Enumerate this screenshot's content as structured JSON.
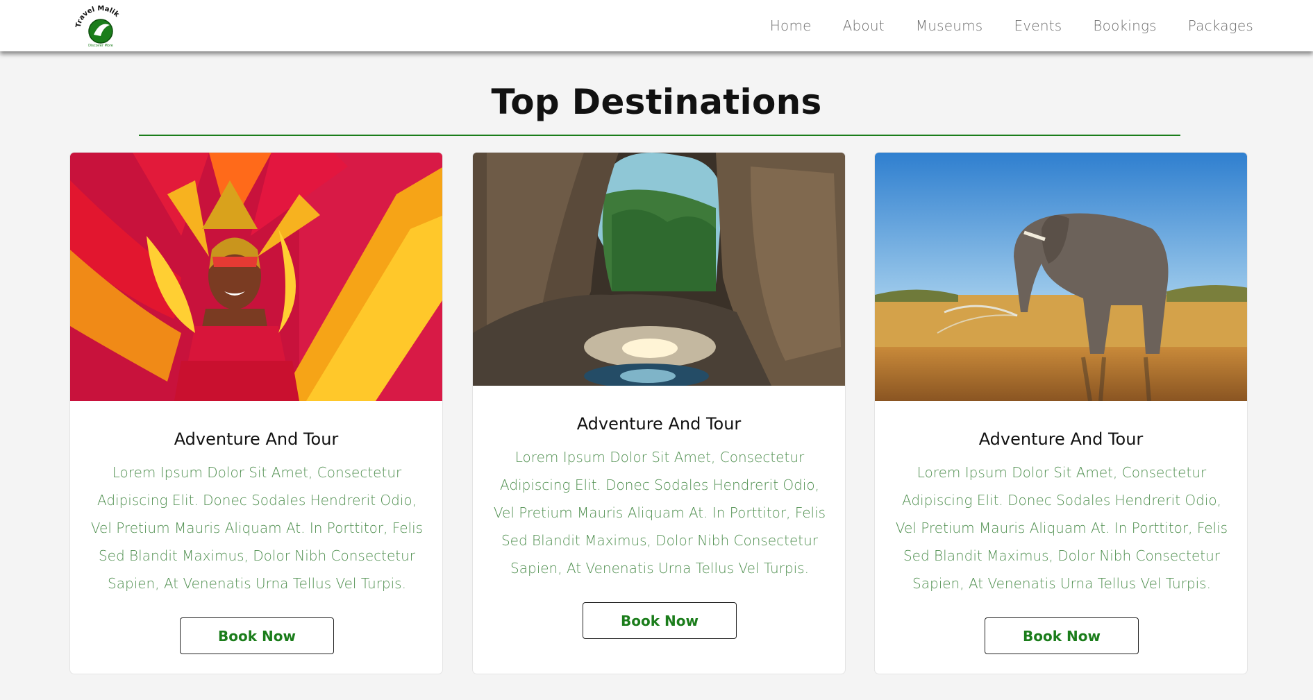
{
  "brand": {
    "logo_text": "Travel Malik",
    "logo_tagline": "Discover More",
    "accent_color": "#1b7d1b"
  },
  "nav": {
    "items": [
      {
        "label": "Home"
      },
      {
        "label": "About"
      },
      {
        "label": "Museums"
      },
      {
        "label": "Events"
      },
      {
        "label": "Bookings"
      },
      {
        "label": "Packages"
      }
    ]
  },
  "section": {
    "title": "Top Destinations"
  },
  "cards": [
    {
      "image": "carnival-dancer-photo",
      "title": "Adventure And Tour",
      "description": "Lorem Ipsum Dolor Sit Amet, Consectetur Adipiscing Elit. Donec Sodales Hendrerit Odio, Vel Pretium Mauris Aliquam At. In Porttitor, Felis Sed Blandit Maximus, Dolor Nibh Consectetur Sapien, At Venenatis Urna Tellus Vel Turpis.",
      "button_label": "Book Now"
    },
    {
      "image": "cave-landscape-photo",
      "title": "Adventure And Tour",
      "description": "Lorem Ipsum Dolor Sit Amet, Consectetur Adipiscing Elit. Donec Sodales Hendrerit Odio, Vel Pretium Mauris Aliquam At. In Porttitor, Felis Sed Blandit Maximus, Dolor Nibh Consectetur Sapien, At Venenatis Urna Tellus Vel Turpis.",
      "button_label": "Book Now"
    },
    {
      "image": "elephant-savanna-photo",
      "title": "Adventure And Tour",
      "description": "Lorem Ipsum Dolor Sit Amet, Consectetur Adipiscing Elit. Donec Sodales Hendrerit Odio, Vel Pretium Mauris Aliquam At. In Porttitor, Felis Sed Blandit Maximus, Dolor Nibh Consectetur Sapien, At Venenatis Urna Tellus Vel Turpis.",
      "button_label": "Book Now"
    }
  ]
}
